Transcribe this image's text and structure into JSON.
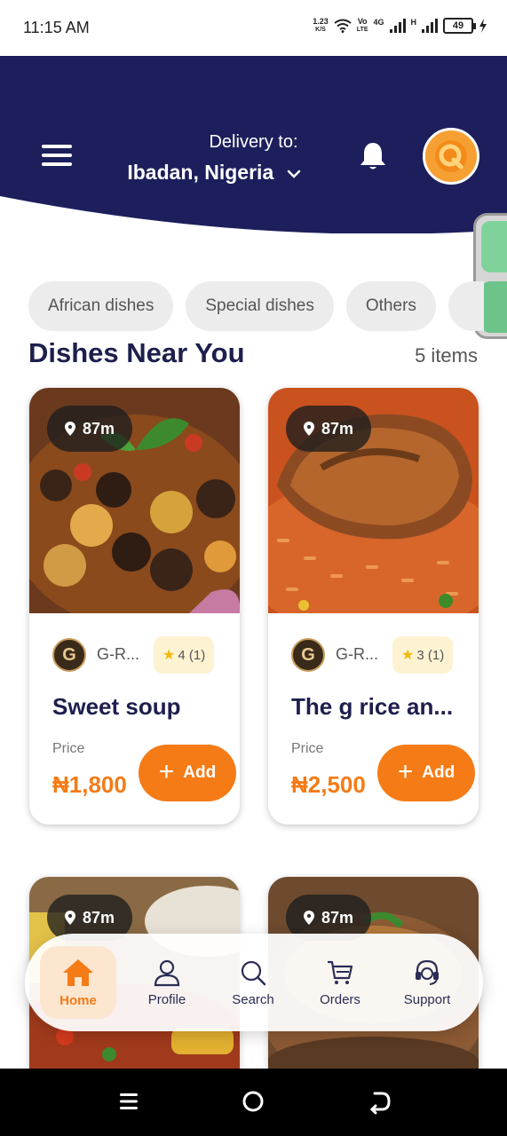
{
  "status_bar": {
    "time": "11:15 AM",
    "net_speed": "1.23",
    "net_unit": "K/S",
    "volte_top": "Vo",
    "volte_bottom": "LTE",
    "net_4g": "4G",
    "net_h": "H",
    "battery": "49"
  },
  "header": {
    "delivery_label": "Delivery to:",
    "location": "Ibadan, Nigeria",
    "colors": {
      "header_bg": "#1d1f5c",
      "accent": "#f57b17"
    }
  },
  "categories": [
    {
      "label": "African dishes"
    },
    {
      "label": "Special dishes"
    },
    {
      "label": "Others"
    }
  ],
  "section": {
    "title": "Dishes Near You",
    "count": "5 items"
  },
  "dishes": [
    {
      "distance": "87m",
      "vendor_initial": "G",
      "vendor": "G-R...",
      "rating": "4 (1)",
      "name": "Sweet soup",
      "price_label": "Price",
      "price": "₦1,800",
      "add_label": "Add"
    },
    {
      "distance": "87m",
      "vendor_initial": "G",
      "vendor": "G-R...",
      "rating": "3 (1)",
      "name": "The g rice an...",
      "price_label": "Price",
      "price": "₦2,500",
      "add_label": "Add"
    },
    {
      "distance": "87m"
    },
    {
      "distance": "87m"
    }
  ],
  "bottom_nav": [
    {
      "label": "Home",
      "icon": "home-icon",
      "active": true
    },
    {
      "label": "Profile",
      "icon": "user-icon",
      "active": false
    },
    {
      "label": "Search",
      "icon": "search-icon",
      "active": false
    },
    {
      "label": "Orders",
      "icon": "cart-icon",
      "active": false
    },
    {
      "label": "Support",
      "icon": "headset-icon",
      "active": false
    }
  ]
}
